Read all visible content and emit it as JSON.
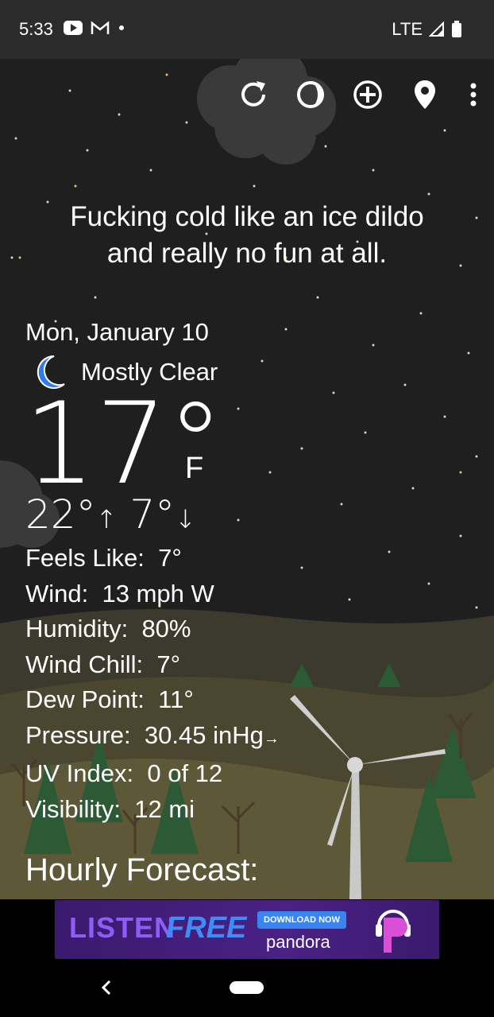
{
  "status_bar": {
    "time": "5:33",
    "network": "LTE",
    "icons": [
      "youtube-icon",
      "gmail-icon",
      "dot-icon",
      "signal-icon",
      "battery-icon"
    ]
  },
  "toolbar": {
    "icons": [
      "refresh-icon",
      "theme-icon",
      "add-location-icon",
      "location-pin-icon",
      "more-vert-icon"
    ]
  },
  "tagline": {
    "line1": "Fucking cold like an ice dildo",
    "line2": "and really no fun at all."
  },
  "weather": {
    "date": "Mon, January 10",
    "condition": "Mostly Clear",
    "condition_icon": "moon-icon",
    "temperature": "17°",
    "unit": "F",
    "high": "22°",
    "high_arrow": "↑",
    "low": "7°",
    "low_arrow": "↓"
  },
  "details": [
    {
      "label": "Feels Like:",
      "value": "7°"
    },
    {
      "label": "Wind:",
      "value": "13 mph W"
    },
    {
      "label": "Humidity:",
      "value": "80%"
    },
    {
      "label": "Wind Chill:",
      "value": "7°"
    },
    {
      "label": "Dew Point:",
      "value": "11°"
    },
    {
      "label": "Pressure:",
      "value": "30.45 inHg",
      "trend": "→"
    },
    {
      "label": "UV Index:",
      "value": "0 of 12"
    },
    {
      "label": "Visibility:",
      "value": "12 mi"
    }
  ],
  "section_title": "Hourly Forecast:",
  "ad": {
    "listen": "LISTEN",
    "free": "FREE",
    "button": "DOWNLOAD NOW",
    "brand": "pandora"
  },
  "colors": {
    "status_bar": "#2c2c2c",
    "sky": "#1f1f1f",
    "moon": "#2f7bf0",
    "ad_background": "#4a2185"
  }
}
